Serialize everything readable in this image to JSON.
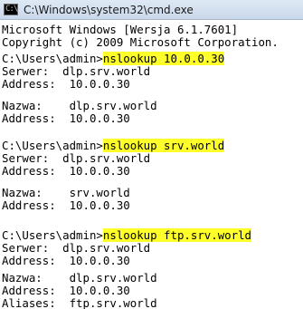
{
  "window": {
    "title": "C:\\Windows\\system32\\cmd.exe",
    "icon": "cmd-icon",
    "icon_glyph": "C:\\"
  },
  "console": {
    "header": [
      "Microsoft Windows [Wersja 6.1.7601]",
      "Copyright (c) 2009 Microsoft Corporation."
    ],
    "sessions": [
      {
        "prompt": "C:\\Users\\admin>",
        "command": "nslookup 10.0.0.30",
        "output": [
          "Serwer:  dlp.srv.world",
          "Address:  10.0.0.30",
          "",
          "Nazwa:    dlp.srv.world",
          "Address:  10.0.0.30"
        ]
      },
      {
        "prompt": "C:\\Users\\admin>",
        "command": "nslookup srv.world",
        "output": [
          "Serwer:  dlp.srv.world",
          "Address:  10.0.0.30",
          "",
          "Nazwa:    srv.world",
          "Address:  10.0.0.30"
        ]
      },
      {
        "prompt": "C:\\Users\\admin>",
        "command": "nslookup ftp.srv.world",
        "output": [
          "Serwer:  dlp.srv.world",
          "Address:  10.0.0.30",
          "",
          "Nazwa:    dlp.srv.world",
          "Address:  10.0.0.30",
          "Aliases:  ftp.srv.world"
        ]
      }
    ]
  },
  "colors": {
    "highlight": "#ffff2a",
    "text": "#000000",
    "background": "#ffffff"
  }
}
